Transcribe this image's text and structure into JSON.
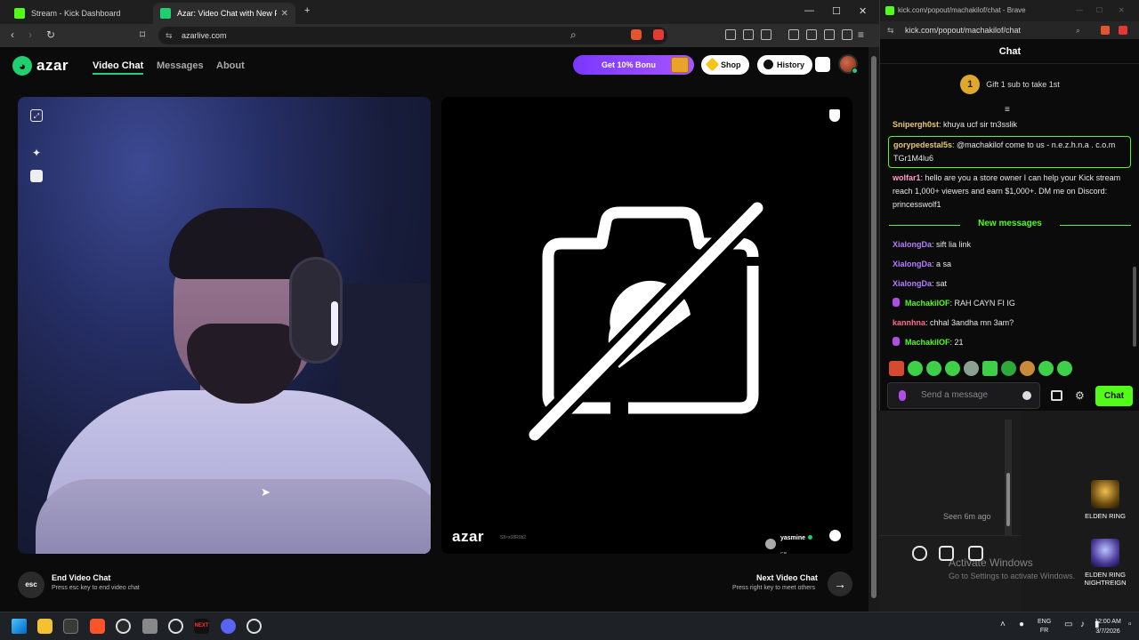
{
  "left_browser": {
    "tabs": [
      {
        "title": "Stream - Kick Dashboard",
        "favicon_color": "#53fc18"
      },
      {
        "title": "Azar: Video Chat with New Pe",
        "favicon_color": "#20d070"
      }
    ],
    "url": "azarlive.com"
  },
  "azar": {
    "logo_text": "azar",
    "nav": [
      "Video Chat",
      "Messages",
      "About"
    ],
    "bonus_label": "Get 10% Bonu",
    "shop_label": "Shop",
    "history_label": "History",
    "watermark_logo": "azar",
    "watermark_id": "S8×x08R0b2",
    "peer_name": "yasmine",
    "peer_country": "GB",
    "end_key": "esc",
    "end_title": "End Video Chat",
    "end_sub": "Press esc key to end video chat",
    "next_title": "Next Video Chat",
    "next_sub": "Press right key to meet others"
  },
  "chat_window": {
    "title": "kick.com/popout/machakilof/chat - Brave",
    "url": "kick.com/popout/machakilof/chat",
    "header": "Chat",
    "gift_number": "1",
    "gift_text": "Gift 1 sub to take 1st",
    "messages_before": [
      {
        "user": "Snipergh0st",
        "color": "#e8c872",
        "text": "khuya ucf sir tn3sslik"
      },
      {
        "user": "gorypedestal5s",
        "color": "#e8c872",
        "text": "@machakilof come to us - n.e.z.h.n.a . c.o.m TGr1M4lu6"
      },
      {
        "user": "wolfar1",
        "color": "#ff9ec8",
        "text": "hello are you a store owner I can help your Kick stream reach 1,000+ viewers and earn $1,000+. DM me on Discord: princesswolf1"
      }
    ],
    "new_messages_label": "New messages",
    "messages_after": [
      {
        "user": "XialongDa",
        "color": "#b77cff",
        "text": "sift lia link",
        "badge": false
      },
      {
        "user": "XialongDa",
        "color": "#b77cff",
        "text": "a sa",
        "badge": false
      },
      {
        "user": "XialongDa",
        "color": "#b77cff",
        "text": "sat",
        "badge": false
      },
      {
        "user": "MachakilOF",
        "color": "#53fc18",
        "text": "RAH CAYN FI IG",
        "badge": true
      },
      {
        "user": "kannhna",
        "color": "#ff6b8a",
        "text": "chhal 3andha mn 3am?",
        "badge": false
      },
      {
        "user": "MachakilOF",
        "color": "#53fc18",
        "text": "21",
        "badge": true
      }
    ],
    "send_placeholder": "Send a message",
    "send_button": "Chat",
    "accent": "#53fc18"
  },
  "messenger": {
    "seen_text": "Seen 6m ago"
  },
  "os": {
    "watermark_title": "Activate Windows",
    "watermark_sub": "Go to Settings to activate Windows.",
    "desktop_icons": [
      "ELDEN RING",
      "ELDEN RING NIGHTREIGN"
    ],
    "lang_top": "ENG",
    "lang_bottom": "FR",
    "time": "12:00 AM",
    "date": "3/7/2026"
  }
}
